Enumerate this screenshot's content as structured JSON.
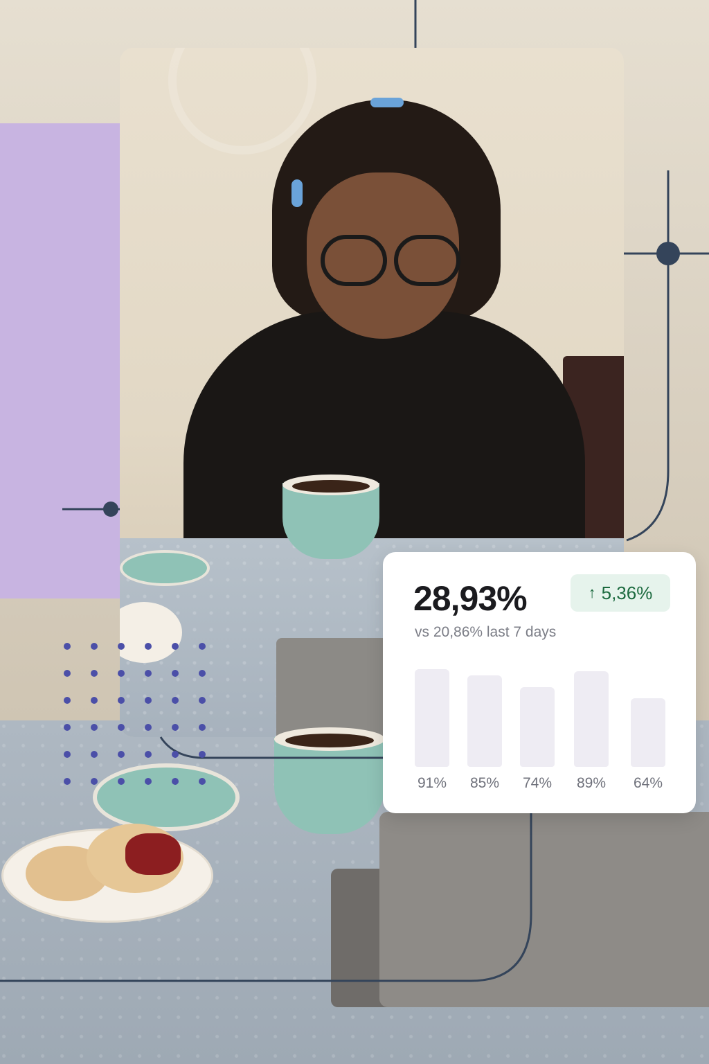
{
  "stats_card": {
    "value": "28,93%",
    "change_badge": "5,36%",
    "change_icon": "arrow-up-icon",
    "comparison": "vs 20,86% last 7 days",
    "bars": [
      {
        "label": "91%",
        "value": 91
      },
      {
        "label": "85%",
        "value": 85
      },
      {
        "label": "74%",
        "value": 74
      },
      {
        "label": "89%",
        "value": 89
      },
      {
        "label": "64%",
        "value": 64
      }
    ]
  },
  "colors": {
    "accent_lilac": "#c8b4e1",
    "line_navy": "#34445a",
    "badge_bg": "#e6f3ec",
    "badge_text": "#1c6a3f",
    "dots": "#4b4fa8",
    "bar_fill": "#eeecf3"
  }
}
